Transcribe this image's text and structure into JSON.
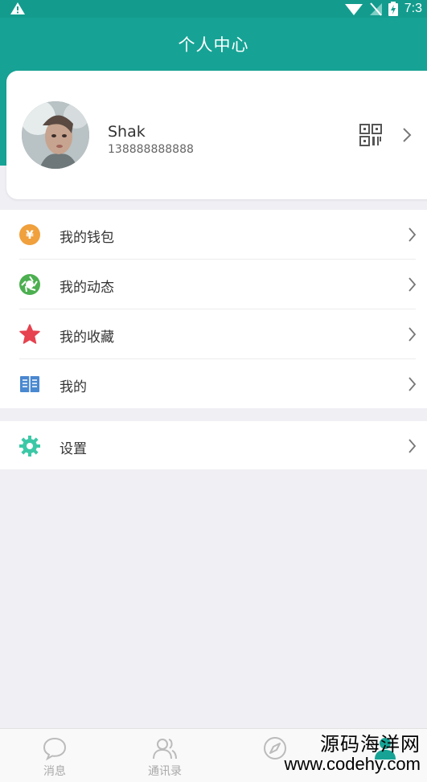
{
  "status_bar": {
    "time": "7:3"
  },
  "header": {
    "title": "个人中心"
  },
  "profile": {
    "name": "Shak",
    "phone": "138888888888"
  },
  "menu": {
    "group1": [
      {
        "label": "我的钱包",
        "icon": "wallet-icon",
        "color": "#f0a03c"
      },
      {
        "label": "我的动态",
        "icon": "moments-icon",
        "color": "#4caf50"
      },
      {
        "label": "我的收藏",
        "icon": "star-icon",
        "color": "#e6424f"
      },
      {
        "label": "我的",
        "icon": "book-icon",
        "color": "#4a88d0"
      }
    ],
    "group2": [
      {
        "label": "设置",
        "icon": "gear-icon",
        "color": "#3cc8a6"
      }
    ]
  },
  "tabs": [
    {
      "label": "消息",
      "icon": "chat-icon"
    },
    {
      "label": "通讯录",
      "icon": "contacts-icon"
    },
    {
      "label": "",
      "icon": "compass-icon"
    },
    {
      "label": "",
      "icon": "profile-icon"
    }
  ],
  "watermark": {
    "line1": "源码海洋网",
    "line2": "www.codehy.com"
  },
  "colors": {
    "primary": "#16a395",
    "background": "#efeff4"
  }
}
